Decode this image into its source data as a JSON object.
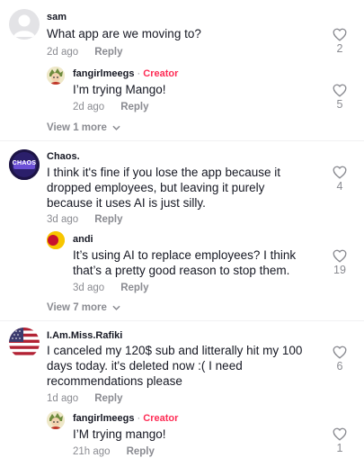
{
  "comments": [
    {
      "username": "sam",
      "text": "What app are we moving to?",
      "time": "2d ago",
      "reply_label": "Reply",
      "likes": "2",
      "avatar_icon": "default-avatar",
      "replies": [
        {
          "username": "fangirlmeegs",
          "badge": "Creator",
          "text": "I’m trying Mango!",
          "time": "2d ago",
          "reply_label": "Reply",
          "likes": "5",
          "avatar_icon": "cartoon-avatar"
        }
      ],
      "view_more": "View 1 more"
    },
    {
      "username": "Chaos.",
      "text": "I think it's fine if you lose the app because it dropped employees, but leaving it purely because it uses AI is just silly.",
      "time": "3d ago",
      "reply_label": "Reply",
      "likes": "4",
      "avatar_icon": "chaos-logo-avatar",
      "avatar_text": "CHAOS",
      "replies": [
        {
          "username": "andi",
          "text": "It’s using AI to replace employees? I think that’s a pretty good reason to stop them.",
          "time": "3d ago",
          "reply_label": "Reply",
          "likes": "19",
          "avatar_icon": "red-yellow-avatar"
        }
      ],
      "view_more": "View 7 more"
    },
    {
      "username": "I.Am.Miss.Rafiki",
      "text": "I canceled my 120$ sub and litterally hit my 100 days today. it's deleted now :( I need recommendations please",
      "time": "1d ago",
      "reply_label": "Reply",
      "likes": "6",
      "avatar_icon": "us-flag-avatar",
      "replies": [
        {
          "username": "fangirlmeegs",
          "badge": "Creator",
          "text": "I’M trying mango!",
          "time": "21h ago",
          "reply_label": "Reply",
          "likes": "1",
          "avatar_icon": "cartoon-avatar"
        }
      ]
    }
  ],
  "badge_separator": "·",
  "colors": {
    "text": "#161823",
    "secondary": "#8a8b91",
    "creator_badge": "#fe2c55"
  }
}
